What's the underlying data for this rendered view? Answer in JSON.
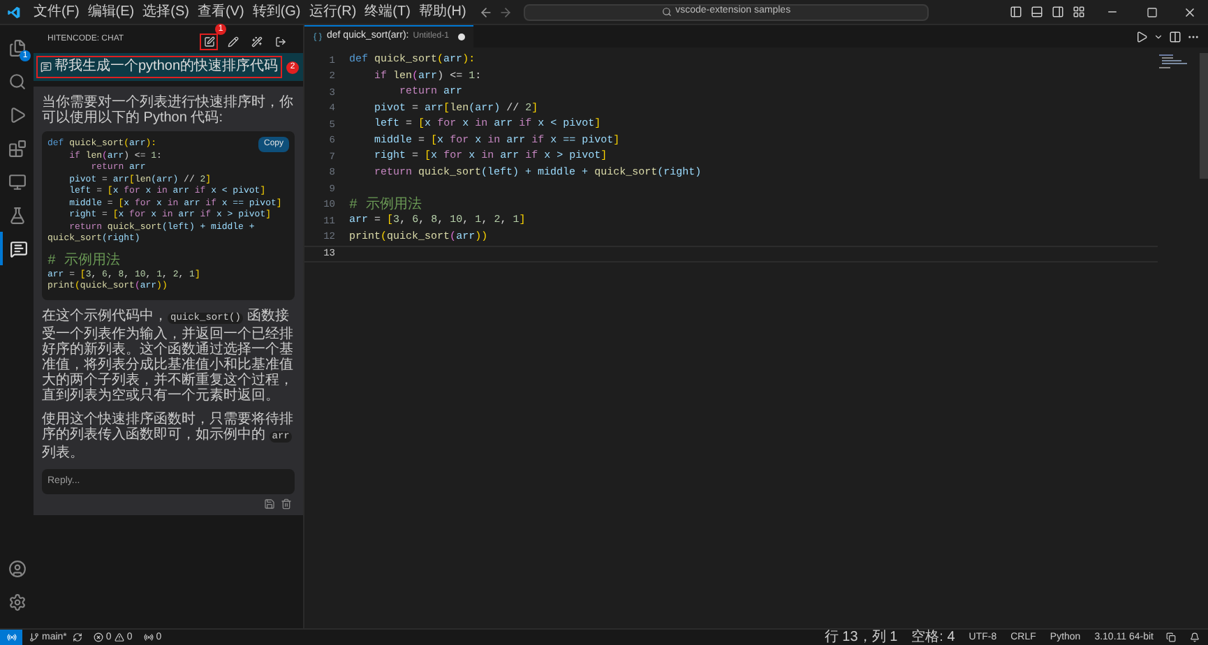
{
  "menu": [
    "文件(F)",
    "编辑(E)",
    "选择(S)",
    "查看(V)",
    "转到(G)",
    "运行(R)",
    "终端(T)",
    "帮助(H)"
  ],
  "search": {
    "value": "vscode-extension samples"
  },
  "activity": [
    {
      "kind": "files",
      "selected": false,
      "badge": "1"
    },
    {
      "kind": "search",
      "selected": false
    },
    {
      "kind": "debug",
      "selected": false
    },
    {
      "kind": "extensions",
      "selected": false
    },
    {
      "kind": "remote",
      "selected": false
    },
    {
      "kind": "testing",
      "selected": false
    },
    {
      "kind": "chat",
      "selected": true
    }
  ],
  "chat": {
    "title": "HITENCODE: CHAT",
    "toolbar": [
      {
        "kind": "new",
        "annotated": true,
        "marker": "1"
      },
      {
        "kind": "edit",
        "annotated": false
      },
      {
        "kind": "clear",
        "annotated": false
      },
      {
        "kind": "exit",
        "annotated": false
      }
    ],
    "question": {
      "text": "帮我生成一个python的快速排序代码",
      "annotated": true,
      "marker": "2"
    },
    "intro": "当你需要对一个列表进行快速排序时，你可以使用以下的 Python 代码:",
    "copy_button": "Copy",
    "code": [
      {
        "kind": "code",
        "tokens": [
          {
            "text": "def ",
            "kind": "def"
          },
          {
            "text": "quick_sort",
            "kind": "fn"
          },
          {
            "text": "(",
            "kind": "br1"
          },
          {
            "text": "arr",
            "kind": "var"
          },
          {
            "text": "):",
            "kind": "br1"
          }
        ]
      },
      {
        "kind": "code",
        "tokens": [
          {
            "text": "    if ",
            "kind": "ctl"
          },
          {
            "text": "len",
            "kind": "fn"
          },
          {
            "text": "(",
            "kind": "br2"
          },
          {
            "text": "arr",
            "kind": "var"
          },
          {
            "text": ") <= ",
            "kind": "op"
          },
          {
            "text": "1",
            "kind": "num"
          },
          {
            "text": ":",
            "kind": "op"
          }
        ]
      },
      {
        "kind": "code",
        "tokens": [
          {
            "text": "        return ",
            "kind": "ctl"
          },
          {
            "text": "arr",
            "kind": "var"
          }
        ]
      },
      {
        "kind": "code",
        "tokens": [
          {
            "text": "    pivot",
            "kind": "var"
          },
          {
            "text": " = ",
            "kind": "op"
          },
          {
            "text": "arr",
            "kind": "var"
          },
          {
            "text": "[",
            "kind": "br1"
          },
          {
            "text": "len",
            "kind": "fn"
          },
          {
            "text": "(arr)",
            "kind": "var"
          },
          {
            "text": " // ",
            "kind": "op"
          },
          {
            "text": "2",
            "kind": "num"
          },
          {
            "text": "]",
            "kind": "br1"
          }
        ]
      },
      {
        "kind": "code",
        "tokens": [
          {
            "text": "    left",
            "kind": "var"
          },
          {
            "text": " = ",
            "kind": "op"
          },
          {
            "text": "[",
            "kind": "br1"
          },
          {
            "text": "x ",
            "kind": "var"
          },
          {
            "text": "for ",
            "kind": "ctl"
          },
          {
            "text": "x ",
            "kind": "var"
          },
          {
            "text": "in ",
            "kind": "ctl"
          },
          {
            "text": "arr ",
            "kind": "var"
          },
          {
            "text": "if ",
            "kind": "ctl"
          },
          {
            "text": "x < pivot",
            "kind": "var"
          },
          {
            "text": "]",
            "kind": "br1"
          }
        ]
      },
      {
        "kind": "code",
        "tokens": [
          {
            "text": "    middle",
            "kind": "var"
          },
          {
            "text": " = ",
            "kind": "op"
          },
          {
            "text": "[",
            "kind": "br1"
          },
          {
            "text": "x ",
            "kind": "var"
          },
          {
            "text": "for ",
            "kind": "ctl"
          },
          {
            "text": "x ",
            "kind": "var"
          },
          {
            "text": "in ",
            "kind": "ctl"
          },
          {
            "text": "arr ",
            "kind": "var"
          },
          {
            "text": "if ",
            "kind": "ctl"
          },
          {
            "text": "x == pivot",
            "kind": "var"
          },
          {
            "text": "]",
            "kind": "br1"
          }
        ]
      },
      {
        "kind": "code",
        "tokens": [
          {
            "text": "    right",
            "kind": "var"
          },
          {
            "text": " = ",
            "kind": "op"
          },
          {
            "text": "[",
            "kind": "br1"
          },
          {
            "text": "x ",
            "kind": "var"
          },
          {
            "text": "for ",
            "kind": "ctl"
          },
          {
            "text": "x ",
            "kind": "var"
          },
          {
            "text": "in ",
            "kind": "ctl"
          },
          {
            "text": "arr ",
            "kind": "var"
          },
          {
            "text": "if ",
            "kind": "ctl"
          },
          {
            "text": "x > pivot",
            "kind": "var"
          },
          {
            "text": "]",
            "kind": "br1"
          }
        ]
      },
      {
        "kind": "code",
        "tokens": [
          {
            "text": "    return ",
            "kind": "ctl"
          },
          {
            "text": "quick_sort",
            "kind": "fn"
          },
          {
            "text": "(left)",
            "kind": "var"
          },
          {
            "text": " + middle + ",
            "kind": "var"
          },
          {
            "text": "quick_sort",
            "kind": "fn"
          },
          {
            "text": "(right)",
            "kind": "var"
          }
        ]
      },
      {
        "kind": "blank"
      },
      {
        "kind": "code",
        "tokens": [
          {
            "text": "# 示例用法",
            "kind": "cm"
          }
        ]
      },
      {
        "kind": "code",
        "tokens": [
          {
            "text": "arr",
            "kind": "var"
          },
          {
            "text": " = ",
            "kind": "op"
          },
          {
            "text": "[",
            "kind": "br1"
          },
          {
            "text": "3",
            "kind": "num"
          },
          {
            "text": ", ",
            "kind": "op"
          },
          {
            "text": "6",
            "kind": "num"
          },
          {
            "text": ", ",
            "kind": "op"
          },
          {
            "text": "8",
            "kind": "num"
          },
          {
            "text": ", ",
            "kind": "op"
          },
          {
            "text": "10",
            "kind": "num"
          },
          {
            "text": ", ",
            "kind": "op"
          },
          {
            "text": "1",
            "kind": "num"
          },
          {
            "text": ", ",
            "kind": "op"
          },
          {
            "text": "2",
            "kind": "num"
          },
          {
            "text": ", ",
            "kind": "op"
          },
          {
            "text": "1",
            "kind": "num"
          },
          {
            "text": "]",
            "kind": "br1"
          }
        ]
      },
      {
        "kind": "code",
        "tokens": [
          {
            "text": "print",
            "kind": "fn"
          },
          {
            "text": "(",
            "kind": "br1"
          },
          {
            "text": "quick_sort",
            "kind": "fn"
          },
          {
            "text": "(",
            "kind": "br2"
          },
          {
            "text": "arr",
            "kind": "var"
          },
          {
            "text": "))",
            "kind": "br1"
          }
        ]
      }
    ],
    "explanation": [
      {
        "kind": "text",
        "text": "在这个示例代码中，"
      },
      {
        "kind": "code",
        "text": "quick_sort()"
      },
      {
        "kind": "text",
        "text": " 函数接受一个列表作为输入，并返回一个已经排好序的新列表。这个函数通过选择一个基准值，将列表分成比基准值小和比基准值大的两个子列表，并不断重复这个过程，直到列表为空或只有一个元素时返回。"
      }
    ],
    "usage": [
      {
        "kind": "text",
        "text": "使用这个快速排序函数时，只需要将待排序的列表传入函数即可，如示例中的 "
      },
      {
        "kind": "code",
        "text": "arr"
      },
      {
        "kind": "text",
        "text": " 列表。"
      }
    ],
    "reply": {
      "placeholder": "Reply..."
    }
  },
  "editor": {
    "tab": {
      "title": "def quick_sort(arr):",
      "file": "Untitled-1",
      "modified": true
    },
    "lines": [
      {
        "number": "1",
        "current": false,
        "tokens": [
          {
            "text": "def ",
            "kind": "def"
          },
          {
            "text": "quick_sort",
            "kind": "fn"
          },
          {
            "text": "(",
            "kind": "br1"
          },
          {
            "text": "arr",
            "kind": "var"
          },
          {
            "text": "):",
            "kind": "br1"
          }
        ]
      },
      {
        "number": "2",
        "current": false,
        "tokens": [
          {
            "text": "    if ",
            "kind": "ctl"
          },
          {
            "text": "len",
            "kind": "fn"
          },
          {
            "text": "(",
            "kind": "br2"
          },
          {
            "text": "arr",
            "kind": "var"
          },
          {
            "text": ") <= ",
            "kind": "op"
          },
          {
            "text": "1",
            "kind": "num"
          },
          {
            "text": ":",
            "kind": "op"
          }
        ]
      },
      {
        "number": "3",
        "current": false,
        "tokens": [
          {
            "text": "        return ",
            "kind": "ctl"
          },
          {
            "text": "arr",
            "kind": "var"
          }
        ]
      },
      {
        "number": "4",
        "current": false,
        "tokens": [
          {
            "text": "    pivot",
            "kind": "var"
          },
          {
            "text": " = ",
            "kind": "op"
          },
          {
            "text": "arr",
            "kind": "var"
          },
          {
            "text": "[",
            "kind": "br1"
          },
          {
            "text": "len",
            "kind": "fn"
          },
          {
            "text": "(arr)",
            "kind": "var"
          },
          {
            "text": " // ",
            "kind": "op"
          },
          {
            "text": "2",
            "kind": "num"
          },
          {
            "text": "]",
            "kind": "br1"
          }
        ]
      },
      {
        "number": "5",
        "current": false,
        "tokens": [
          {
            "text": "    left",
            "kind": "var"
          },
          {
            "text": " = ",
            "kind": "op"
          },
          {
            "text": "[",
            "kind": "br1"
          },
          {
            "text": "x ",
            "kind": "var"
          },
          {
            "text": "for ",
            "kind": "ctl"
          },
          {
            "text": "x ",
            "kind": "var"
          },
          {
            "text": "in ",
            "kind": "ctl"
          },
          {
            "text": "arr ",
            "kind": "var"
          },
          {
            "text": "if ",
            "kind": "ctl"
          },
          {
            "text": "x < pivot",
            "kind": "var"
          },
          {
            "text": "]",
            "kind": "br1"
          }
        ]
      },
      {
        "number": "6",
        "current": false,
        "tokens": [
          {
            "text": "    middle",
            "kind": "var"
          },
          {
            "text": " = ",
            "kind": "op"
          },
          {
            "text": "[",
            "kind": "br1"
          },
          {
            "text": "x ",
            "kind": "var"
          },
          {
            "text": "for ",
            "kind": "ctl"
          },
          {
            "text": "x ",
            "kind": "var"
          },
          {
            "text": "in ",
            "kind": "ctl"
          },
          {
            "text": "arr ",
            "kind": "var"
          },
          {
            "text": "if ",
            "kind": "ctl"
          },
          {
            "text": "x == pivot",
            "kind": "var"
          },
          {
            "text": "]",
            "kind": "br1"
          }
        ]
      },
      {
        "number": "7",
        "current": false,
        "tokens": [
          {
            "text": "    right",
            "kind": "var"
          },
          {
            "text": " = ",
            "kind": "op"
          },
          {
            "text": "[",
            "kind": "br1"
          },
          {
            "text": "x ",
            "kind": "var"
          },
          {
            "text": "for ",
            "kind": "ctl"
          },
          {
            "text": "x ",
            "kind": "var"
          },
          {
            "text": "in ",
            "kind": "ctl"
          },
          {
            "text": "arr ",
            "kind": "var"
          },
          {
            "text": "if ",
            "kind": "ctl"
          },
          {
            "text": "x > pivot",
            "kind": "var"
          },
          {
            "text": "]",
            "kind": "br1"
          }
        ]
      },
      {
        "number": "8",
        "current": false,
        "tokens": [
          {
            "text": "    return ",
            "kind": "ctl"
          },
          {
            "text": "quick_sort",
            "kind": "fn"
          },
          {
            "text": "(left)",
            "kind": "var"
          },
          {
            "text": " + middle + ",
            "kind": "var"
          },
          {
            "text": "quick_sort",
            "kind": "fn"
          },
          {
            "text": "(right)",
            "kind": "var"
          }
        ]
      },
      {
        "number": "9",
        "current": false
      },
      {
        "number": "10",
        "current": false,
        "tokens": [
          {
            "text": "# 示例用法",
            "kind": "cm"
          }
        ]
      },
      {
        "number": "11",
        "current": false,
        "tokens": [
          {
            "text": "arr",
            "kind": "var"
          },
          {
            "text": " = ",
            "kind": "op"
          },
          {
            "text": "[",
            "kind": "br1"
          },
          {
            "text": "3",
            "kind": "num"
          },
          {
            "text": ", ",
            "kind": "op"
          },
          {
            "text": "6",
            "kind": "num"
          },
          {
            "text": ", ",
            "kind": "op"
          },
          {
            "text": "8",
            "kind": "num"
          },
          {
            "text": ", ",
            "kind": "op"
          },
          {
            "text": "10",
            "kind": "num"
          },
          {
            "text": ", ",
            "kind": "op"
          },
          {
            "text": "1",
            "kind": "num"
          },
          {
            "text": ", ",
            "kind": "op"
          },
          {
            "text": "2",
            "kind": "num"
          },
          {
            "text": ", ",
            "kind": "op"
          },
          {
            "text": "1",
            "kind": "num"
          },
          {
            "text": "]",
            "kind": "br1"
          }
        ]
      },
      {
        "number": "12",
        "current": false,
        "tokens": [
          {
            "text": "print",
            "kind": "fn"
          },
          {
            "text": "(",
            "kind": "br1"
          },
          {
            "text": "quick_sort",
            "kind": "fn"
          },
          {
            "text": "(",
            "kind": "br2"
          },
          {
            "text": "arr",
            "kind": "var"
          },
          {
            "text": "))",
            "kind": "br1"
          }
        ]
      },
      {
        "number": "13",
        "current": true
      }
    ]
  },
  "status": {
    "branch": "main*",
    "errors": "0",
    "warnings": "0",
    "ports": "0",
    "right": [
      "行 13，列 1",
      "空格: 4",
      "UTF-8",
      "CRLF",
      "Python",
      "3.10.11 64-bit"
    ]
  }
}
